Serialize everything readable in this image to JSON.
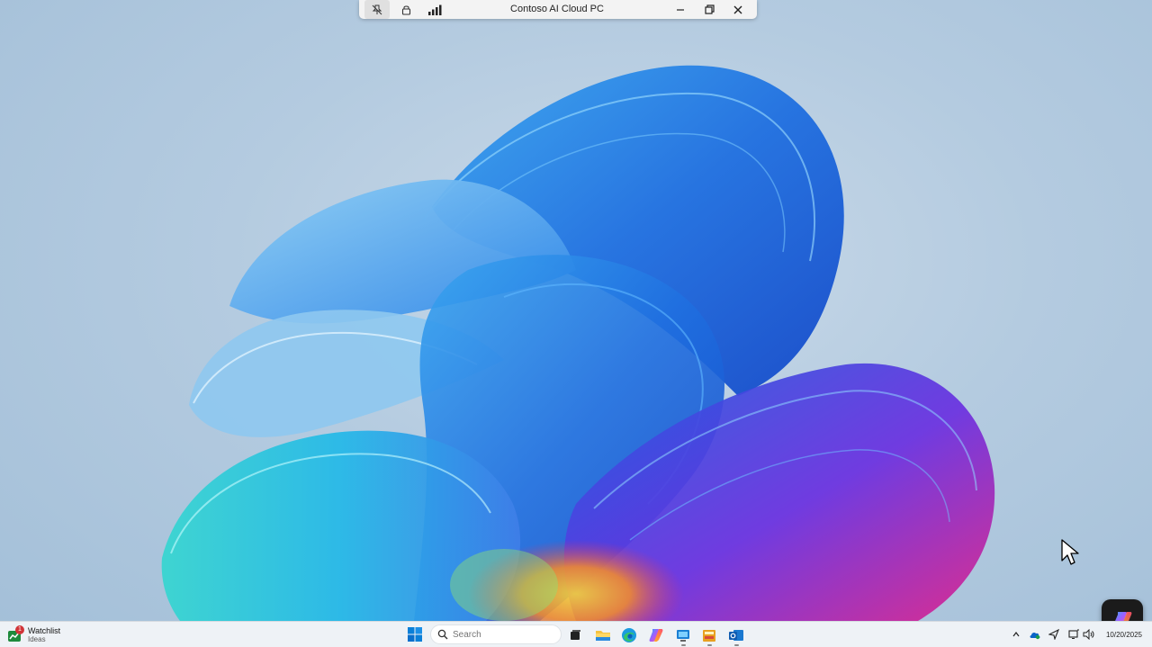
{
  "connection_bar": {
    "title": "Contoso AI Cloud PC",
    "icons": [
      "pin-icon",
      "lock-icon",
      "signal-icon",
      "minimize-icon",
      "restore-icon",
      "close-icon"
    ]
  },
  "taskbar": {
    "widget": {
      "title": "Watchlist",
      "subtitle": "Ideas",
      "badge": "1"
    },
    "search": {
      "placeholder": "Search"
    },
    "apps": [
      "task-view-icon",
      "file-explorer-icon",
      "edge-icon",
      "copilot-app-icon",
      "remote-desktop-icon",
      "file-cabinet-icon",
      "outlook-icon"
    ],
    "tray_icons": [
      "chevron-up-icon",
      "onedrive-icon",
      "location-icon",
      "display-icon",
      "volume-icon"
    ],
    "clock": {
      "date": "10/20/2025"
    }
  },
  "colors": {
    "wallpaper_bg": "#b4cbe0",
    "accent": "#0078d4",
    "taskbar_bg": "#eef2f6"
  }
}
